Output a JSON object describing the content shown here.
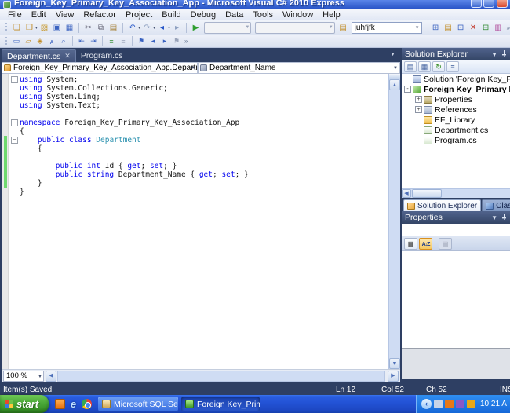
{
  "window": {
    "title": "Foreign_Key_Primary_Key_Association_App - Microsoft Visual C# 2010 Express"
  },
  "menu": {
    "items": [
      "File",
      "Edit",
      "View",
      "Refactor",
      "Project",
      "Build",
      "Debug",
      "Data",
      "Tools",
      "Window",
      "Help"
    ]
  },
  "toolbar1": {
    "search_value": "juhfjfk",
    "icons_left": [
      {
        "name": "new-project-icon",
        "glyph": "❏",
        "color": "#c08a20"
      },
      {
        "name": "add-new-item-icon",
        "glyph": "❐",
        "color": "#c08a20",
        "dropdown": true
      },
      {
        "name": "open-file-icon",
        "glyph": "▨",
        "color": "#c89a30"
      },
      {
        "name": "save-icon",
        "glyph": "▣",
        "color": "#3a62c0"
      },
      {
        "name": "save-all-icon",
        "glyph": "▦",
        "color": "#3a62c0"
      },
      {
        "name": "separator"
      },
      {
        "name": "cut-icon",
        "glyph": "✂",
        "color": "#667"
      },
      {
        "name": "copy-icon",
        "glyph": "⧉",
        "color": "#667"
      },
      {
        "name": "paste-icon",
        "glyph": "▤",
        "color": "#a07828"
      },
      {
        "name": "separator"
      },
      {
        "name": "undo-icon",
        "glyph": "↶",
        "color": "#2858c8",
        "dropdown": true
      },
      {
        "name": "redo-icon",
        "glyph": "↷",
        "color": "#8ea0c0",
        "dropdown": true
      },
      {
        "name": "navigate-backward-icon",
        "glyph": "◂",
        "color": "#2858c8",
        "dropdown": true
      },
      {
        "name": "navigate-forward-icon",
        "glyph": "▸",
        "color": "#8ea0c0"
      },
      {
        "name": "separator"
      },
      {
        "name": "start-debugging-icon",
        "glyph": "▶",
        "color": "#2f9e2f"
      }
    ],
    "icons_right": [
      {
        "name": "notebook-icon",
        "glyph": "▤",
        "color": "#c08a20"
      }
    ],
    "icons_far_right": [
      {
        "name": "solution-explorer-icon",
        "glyph": "⊞",
        "color": "#3a62c0"
      },
      {
        "name": "properties-window-icon",
        "glyph": "▤",
        "color": "#c08a20"
      },
      {
        "name": "object-browser-icon",
        "glyph": "⊡",
        "color": "#3a62c0"
      },
      {
        "name": "error-list-icon",
        "glyph": "✕",
        "color": "#c03020"
      },
      {
        "name": "toolbox-icon",
        "glyph": "⊟",
        "color": "#2f8a2f"
      },
      {
        "name": "extension-manager-icon",
        "glyph": "▥",
        "color": "#b04a9a"
      }
    ],
    "overflow_chevron": "»"
  },
  "toolbar2": {
    "icons": [
      {
        "name": "display-object-member-list-icon",
        "glyph": "▭",
        "color": "#3a62c0"
      },
      {
        "name": "display-parameter-info-icon",
        "glyph": "▱",
        "color": "#c08a20"
      },
      {
        "name": "display-quick-info-icon",
        "glyph": "◈",
        "color": "#c08a20"
      },
      {
        "name": "display-word-completion-icon",
        "glyph": "ᴀ",
        "color": "#3a62c0"
      },
      {
        "name": "navigate-to-icon",
        "glyph": "⌕",
        "color": "#3a62c0"
      },
      {
        "name": "separator"
      },
      {
        "name": "decrease-indent-icon",
        "glyph": "⇤",
        "color": "#3a62c0"
      },
      {
        "name": "increase-indent-icon",
        "glyph": "⇥",
        "color": "#3a62c0"
      },
      {
        "name": "separator"
      },
      {
        "name": "comment-selection-icon",
        "glyph": "≡",
        "color": "#2f8a2f"
      },
      {
        "name": "uncomment-selection-icon",
        "glyph": "≡",
        "color": "#9aa4ba"
      },
      {
        "name": "separator"
      },
      {
        "name": "toggle-bookmark-icon",
        "glyph": "⚑",
        "color": "#3a62c0"
      },
      {
        "name": "prev-bookmark-icon",
        "glyph": "◂",
        "color": "#3a62c0"
      },
      {
        "name": "next-bookmark-icon",
        "glyph": "▸",
        "color": "#3a62c0"
      },
      {
        "name": "clear-bookmarks-icon",
        "glyph": "⚑",
        "color": "#9aa4ba"
      }
    ],
    "overflow_chevron": "»"
  },
  "editor_tabs": [
    {
      "label": "Department.cs",
      "active": true,
      "closable": true
    },
    {
      "label": "Program.cs",
      "active": false,
      "closable": false
    }
  ],
  "navbar": {
    "type_dropdown": "Foreign_Key_Primary_Key_Association_App.Department",
    "member_dropdown": "Department_Name"
  },
  "code": {
    "lines": [
      {
        "fold": "-",
        "changed": false,
        "tokens": [
          [
            "k",
            "using"
          ],
          [
            "p",
            " System;"
          ]
        ]
      },
      {
        "fold": "",
        "changed": false,
        "tokens": [
          [
            "k",
            "using"
          ],
          [
            "p",
            " System.Collections.Generic;"
          ]
        ]
      },
      {
        "fold": "",
        "changed": false,
        "tokens": [
          [
            "k",
            "using"
          ],
          [
            "p",
            " System.Linq;"
          ]
        ]
      },
      {
        "fold": "",
        "changed": false,
        "tokens": [
          [
            "k",
            "using"
          ],
          [
            "p",
            " System.Text;"
          ]
        ]
      },
      {
        "fold": "",
        "changed": false,
        "tokens": []
      },
      {
        "fold": "-",
        "changed": false,
        "tokens": [
          [
            "k",
            "namespace"
          ],
          [
            "p",
            " Foreign_Key_Primary_Key_Association_App"
          ]
        ]
      },
      {
        "fold": "",
        "changed": false,
        "tokens": [
          [
            "p",
            "{"
          ]
        ]
      },
      {
        "fold": "-",
        "changed": true,
        "tokens": [
          [
            "p",
            "    "
          ],
          [
            "k",
            "public"
          ],
          [
            "p",
            " "
          ],
          [
            "k",
            "class"
          ],
          [
            "p",
            " "
          ],
          [
            "t",
            "Department"
          ]
        ]
      },
      {
        "fold": "",
        "changed": true,
        "tokens": [
          [
            "p",
            "    {"
          ]
        ]
      },
      {
        "fold": "",
        "changed": true,
        "tokens": []
      },
      {
        "fold": "",
        "changed": true,
        "tokens": [
          [
            "p",
            "        "
          ],
          [
            "k",
            "public"
          ],
          [
            "p",
            " "
          ],
          [
            "k",
            "int"
          ],
          [
            "p",
            " Id { "
          ],
          [
            "k",
            "get"
          ],
          [
            "p",
            "; "
          ],
          [
            "k",
            "set"
          ],
          [
            "p",
            "; }"
          ]
        ]
      },
      {
        "fold": "",
        "changed": true,
        "tokens": [
          [
            "p",
            "        "
          ],
          [
            "k",
            "public"
          ],
          [
            "p",
            " "
          ],
          [
            "k",
            "string"
          ],
          [
            "p",
            " Department_Name { "
          ],
          [
            "k",
            "get"
          ],
          [
            "p",
            "; "
          ],
          [
            "k",
            "set"
          ],
          [
            "p",
            "; }"
          ]
        ]
      },
      {
        "fold": "",
        "changed": true,
        "tokens": [
          [
            "p",
            "    }"
          ]
        ]
      },
      {
        "fold": "",
        "changed": false,
        "tokens": [
          [
            "p",
            "}"
          ]
        ]
      }
    ]
  },
  "editor_bottom": {
    "zoom_value": "100 %"
  },
  "solution_explorer": {
    "title": "Solution Explorer",
    "toolbar_icons": [
      {
        "name": "properties-tool-icon",
        "glyph": "▤"
      },
      {
        "name": "show-all-files-icon",
        "glyph": "▦"
      },
      {
        "name": "refresh-icon",
        "glyph": "↻"
      },
      {
        "name": "view-code-icon",
        "glyph": "≡"
      }
    ],
    "tree": [
      {
        "label": "Solution 'Foreign Key_Primary Key_A",
        "icon": "solution",
        "indent": 0,
        "expander": "",
        "bold": false
      },
      {
        "label": "Foreign Key_Primary Key_A",
        "icon": "project",
        "indent": 0,
        "expander": "-",
        "bold": true
      },
      {
        "label": "Properties",
        "icon": "properties",
        "indent": 1,
        "expander": "+",
        "bold": false
      },
      {
        "label": "References",
        "icon": "references",
        "indent": 1,
        "expander": "+",
        "bold": false
      },
      {
        "label": "EF_Library",
        "icon": "folder",
        "indent": 1,
        "expander": "",
        "bold": false
      },
      {
        "label": "Department.cs",
        "icon": "csfile",
        "indent": 1,
        "expander": "",
        "bold": false
      },
      {
        "label": "Program.cs",
        "icon": "csfile",
        "indent": 1,
        "expander": "",
        "bold": false
      }
    ]
  },
  "panel_tabs": [
    {
      "label": "Solution Explorer",
      "active": true,
      "icon": "se"
    },
    {
      "label": "Class View",
      "active": false,
      "icon": "cv"
    }
  ],
  "properties_panel": {
    "title": "Properties"
  },
  "status_bar": {
    "message": "Item(s) Saved",
    "ln": "Ln 12",
    "col": "Col 52",
    "ch": "Ch 52",
    "mode": "INS"
  },
  "taskbar": {
    "start_label": "start",
    "quick_launch": [
      {
        "name": "quick-launch-orange-app-icon",
        "type": "orange"
      },
      {
        "name": "quick-launch-internet-explorer-icon",
        "type": "ie",
        "glyph": "e"
      },
      {
        "name": "quick-launch-chrome-icon",
        "type": "chrome"
      }
    ],
    "tasks": [
      {
        "label": "Microsoft SQL Server ...",
        "active": false,
        "icon": "sql"
      },
      {
        "label": "Foreign Key_Primary ...",
        "active": true,
        "icon": "vs"
      }
    ],
    "help_badge": "?",
    "tray_chevron": "‹",
    "tray_icons": [
      {
        "name": "tray-messenger-icon",
        "color": "#c8d4e8"
      },
      {
        "name": "tray-alert-icon",
        "color": "#e87818"
      },
      {
        "name": "tray-windows-update-icon",
        "color": "#8858c8"
      },
      {
        "name": "tray-security-icon",
        "color": "#e8a818"
      }
    ],
    "clock": "10:21 AM"
  }
}
